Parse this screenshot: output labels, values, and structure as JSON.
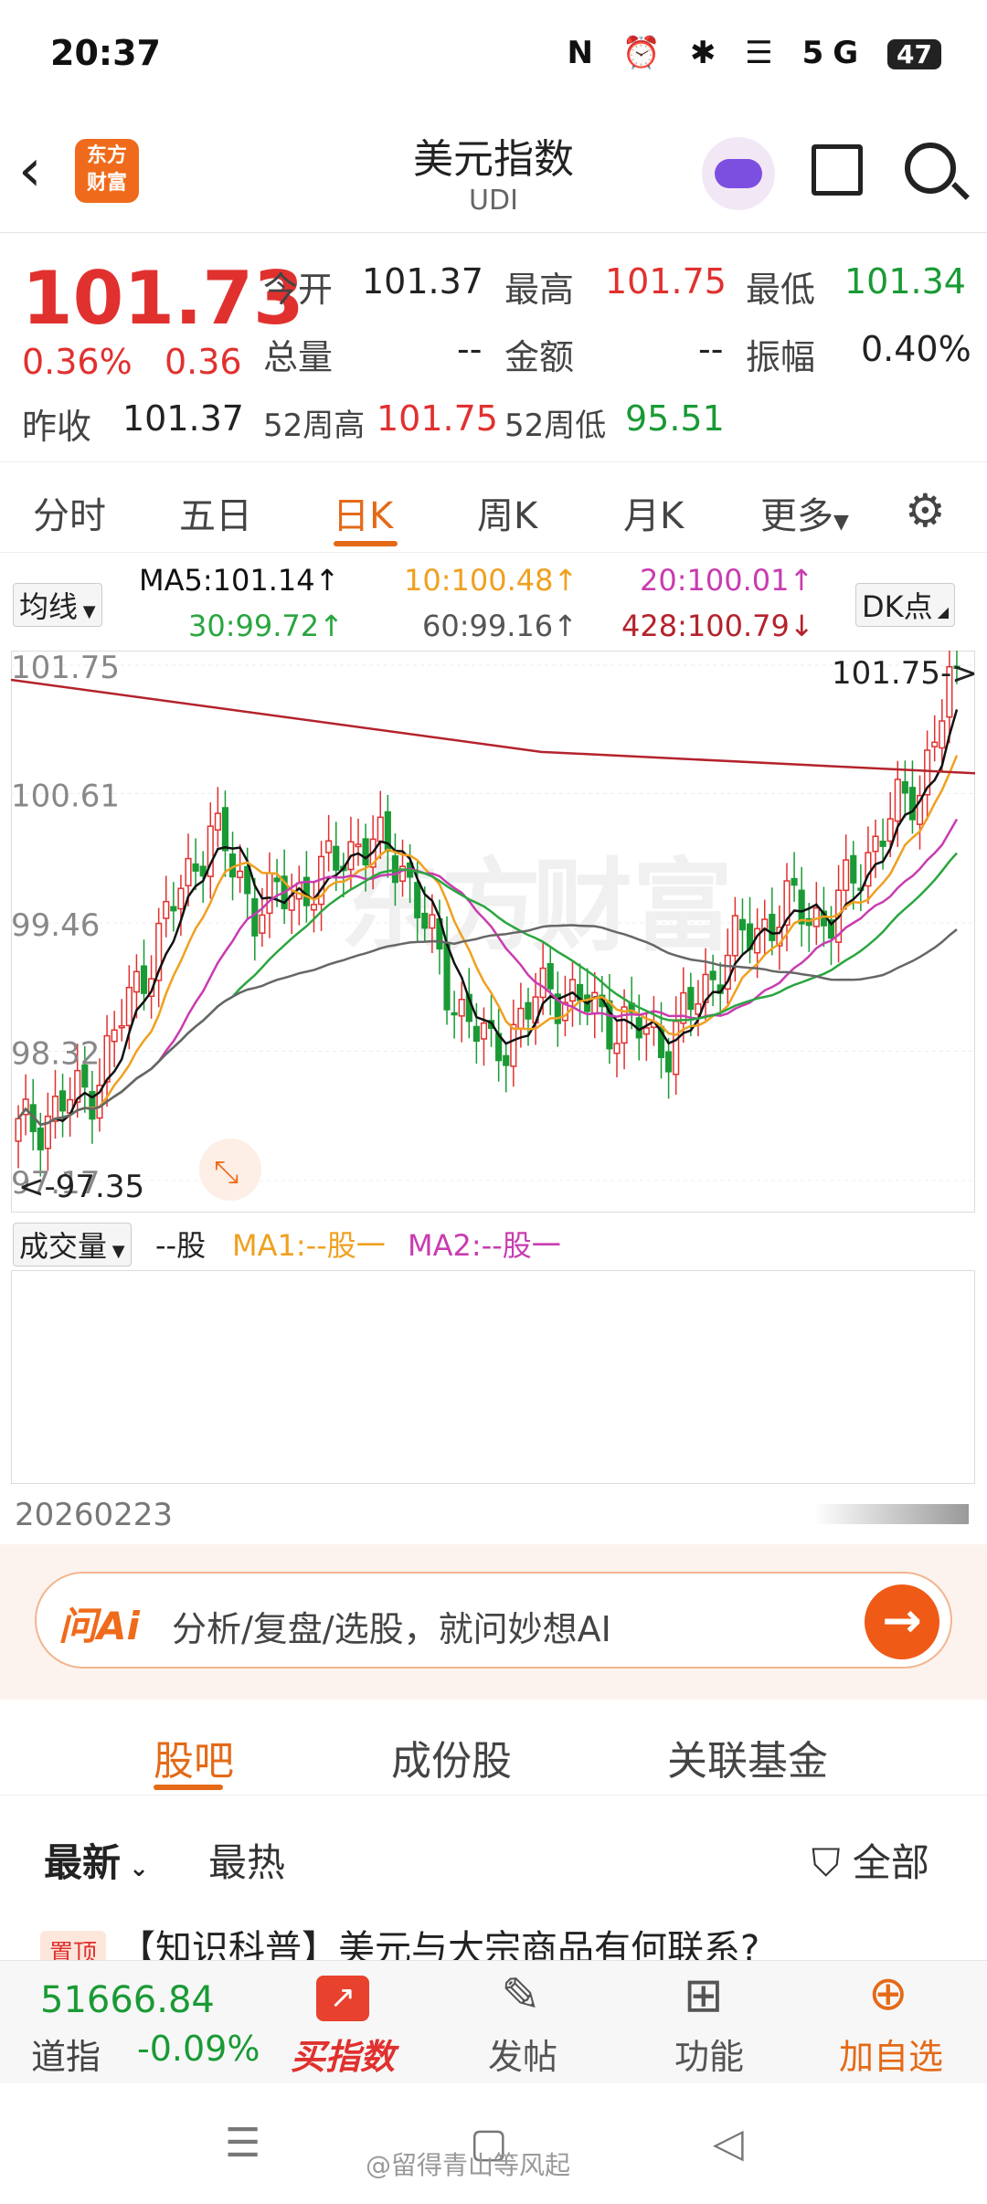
{
  "status": {
    "time": "20:37",
    "icons": "N ⏰ ✱ ☰ 5G",
    "battery": "47"
  },
  "header": {
    "title": "美元指数",
    "code": "UDI",
    "logo_line1": "东方",
    "logo_line2": "财富"
  },
  "quote": {
    "price": "101.73",
    "change_pct": "0.36%",
    "change": "0.36",
    "open_label": "今开",
    "open": "101.37",
    "high_label": "最高",
    "high": "101.75",
    "low_label": "最低",
    "low": "101.34",
    "vol_label": "总量",
    "vol": "--",
    "amt_label": "金额",
    "amt": "--",
    "amp_label": "振幅",
    "amp": "0.40%",
    "prev_label": "昨收",
    "prev": "101.37",
    "w52h_label": "52周高",
    "w52h": "101.75",
    "w52l_label": "52周低",
    "w52l": "95.51"
  },
  "ktabs": [
    "分时",
    "五日",
    "日K",
    "周K",
    "月K",
    "更多"
  ],
  "ma": {
    "selector": "均线",
    "ma5": "MA5:101.14↑",
    "ma10": "10:100.48↑",
    "ma20": "20:100.01↑",
    "ma30": "30:99.72↑",
    "ma60": "60:99.16↑",
    "ma428": "428:100.79↓",
    "dk": "DK点"
  },
  "chart_data": {
    "type": "candlestick",
    "y_ticks": [
      "101.75",
      "100.61",
      "99.46",
      "98.32",
      "97.17"
    ],
    "ylim": [
      97.17,
      101.75
    ],
    "high_marker": "101.75->",
    "low_marker": "<-97.35",
    "date": "20260223",
    "colors": {
      "up": "#e0312f",
      "down": "#1a9a35",
      "ma5": "#111111",
      "ma10": "#f0a020",
      "ma20": "#c83cb0",
      "ma30": "#2aa640",
      "ma60": "#666666",
      "ma428": "#b4232c"
    }
  },
  "volume": {
    "selector": "成交量",
    "unit": "--股",
    "ma1": "MA1:--股一",
    "ma2": "MA2:--股一"
  },
  "ai": {
    "logo": "问Ai",
    "placeholder": "分析/复盘/选股，就问妙想AI",
    "arrow": "→"
  },
  "guba_tabs": [
    "股吧",
    "成份股",
    "关联基金"
  ],
  "sub_tabs": {
    "latest": "最新",
    "hot": "最热",
    "filter": "全部"
  },
  "post": {
    "pin": "置顶",
    "title": "【知识科普】美元与大宗商品有何联系?"
  },
  "bottom_nav": {
    "index_value": "51666.84",
    "index_name": "道指",
    "index_change": "-0.09%",
    "buy_index": "买指数",
    "post": "发帖",
    "functions": "功能",
    "add_watch": "加自选"
  },
  "watermark": "@留得青山等风起"
}
